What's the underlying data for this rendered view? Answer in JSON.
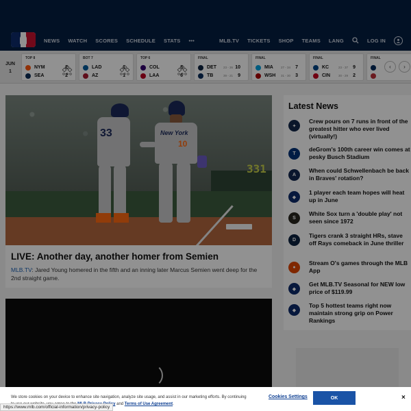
{
  "nav": {
    "left": [
      "NEWS",
      "WATCH",
      "SCORES",
      "SCHEDULE",
      "STATS"
    ],
    "more": "•••",
    "right": [
      "MLB.TV",
      "TICKETS",
      "SHOP",
      "TEAMS",
      "LANG"
    ],
    "login": "LOG IN"
  },
  "scoreboard": {
    "date": [
      "JUN",
      "1"
    ],
    "games": [
      {
        "status": "TOP 8",
        "teams": [
          {
            "abbr": "NYM",
            "score": "2",
            "color": "#ff5910"
          },
          {
            "abbr": "SEA",
            "score": "2",
            "color": "#0c2c56"
          }
        ],
        "live": true
      },
      {
        "status": "BOT 7",
        "teams": [
          {
            "abbr": "LAD",
            "score": "1",
            "color": "#005a9c"
          },
          {
            "abbr": "AZ",
            "score": "1",
            "color": "#a71930"
          }
        ],
        "live": true
      },
      {
        "status": "TOP 6",
        "teams": [
          {
            "abbr": "COL",
            "score": "3",
            "color": "#33006f"
          },
          {
            "abbr": "LAA",
            "score": "6",
            "color": "#ba0021"
          }
        ],
        "live": true
      },
      {
        "status": "FINAL",
        "teams": [
          {
            "abbr": "DET",
            "record": "23 - 36",
            "score": "10",
            "color": "#0c2340"
          },
          {
            "abbr": "TB",
            "record": "39 - 21",
            "score": "9",
            "color": "#092c5c"
          }
        ],
        "live": false
      },
      {
        "status": "FINAL",
        "teams": [
          {
            "abbr": "MIA",
            "record": "27 - 34",
            "score": "7",
            "color": "#00a3e0"
          },
          {
            "abbr": "WSH",
            "record": "31 - 30",
            "score": "3",
            "color": "#ab0003"
          }
        ],
        "live": false
      },
      {
        "status": "FINAL",
        "teams": [
          {
            "abbr": "KC",
            "record": "23 - 37",
            "score": "9",
            "color": "#004687"
          },
          {
            "abbr": "CIN",
            "record": "30 - 29",
            "score": "2",
            "color": "#c6011f"
          }
        ],
        "live": false
      },
      {
        "status": "FINAL",
        "teams": [
          {
            "abbr": "",
            "score": "",
            "color": "#002b5c"
          },
          {
            "abbr": "",
            "score": "",
            "color": "#bd3039"
          }
        ],
        "live": false
      }
    ],
    "prev": "‹",
    "next": "›"
  },
  "hero": {
    "wall_number": "331",
    "jersey_left": "33",
    "jersey_right": "10",
    "jersey_script": "New York",
    "title": "LIVE: Another day, another homer from Semien",
    "source": "MLB.TV",
    "summary": ": Jared Young homered in the fifth and an inning later Marcus Semien went deep for the 2nd straight game."
  },
  "news": {
    "heading": "Latest News",
    "items": [
      {
        "text": "Crew pours on 7 runs in front of the greatest hitter who ever lived (virtually!)",
        "color": "#12284b",
        "icon": "brewers-logo-icon",
        "glyph": "✦"
      },
      {
        "text": "deGrom's 100th career win comes at pesky Busch Stadium",
        "color": "#003278",
        "icon": "rangers-logo-icon",
        "glyph": "T"
      },
      {
        "text": "When could Schwellenbach be back in Braves' rotation?",
        "color": "#13274f",
        "icon": "braves-logo-icon",
        "glyph": "A"
      },
      {
        "text": "1 player each team hopes will heat up in June",
        "color": "#0d2b6b",
        "icon": "mlb-logo-icon",
        "glyph": "◆"
      },
      {
        "text": "White Sox turn a 'double play' not seen since 1972",
        "color": "#27251f",
        "icon": "white-sox-logo-icon",
        "glyph": "S"
      },
      {
        "text": "Tigers crank 3 straight HRs, stave off Rays comeback in June thriller",
        "color": "#0c2340",
        "icon": "tigers-logo-icon",
        "glyph": "D"
      },
      {
        "text": "Stream O's games through the MLB App",
        "color": "#df4601",
        "icon": "orioles-logo-icon",
        "glyph": "●"
      },
      {
        "text": "Get MLB.TV Seasonal for NEW low price of $119.99",
        "color": "#0d2b6b",
        "icon": "mlb-logo-icon",
        "glyph": "◆"
      },
      {
        "text": "Top 5 hottest teams right now maintain strong grip on Power Rankings",
        "color": "#0d2b6b",
        "icon": "mlb-logo-icon",
        "glyph": "◆"
      }
    ]
  },
  "cookie": {
    "text": "We store cookies on your device to enhance site navigation, analyze site usage, and assist in our marketing efforts. By continuing to use our website, you agree to the",
    "policy": "MLB Privacy Policy",
    "and": "and",
    "terms": "Terms of Use Agreement",
    "period": ".",
    "settings": "Cookies Settings",
    "ok": "OK",
    "close": "×"
  },
  "statusbar": "https://www.mlb.com/official-information/privacy-policy"
}
